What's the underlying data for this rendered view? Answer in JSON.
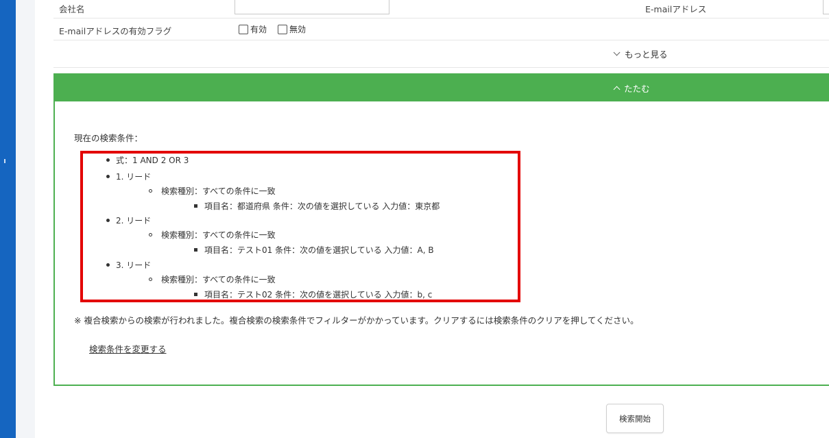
{
  "form": {
    "company_label": "会社名",
    "company_value": "",
    "email_label": "E-mailアドレス",
    "email_value": "",
    "flag_label": "E-mailアドレスの有効フラグ",
    "flag_options": [
      {
        "label": "有効",
        "checked": false
      },
      {
        "label": "無効",
        "checked": false
      }
    ],
    "more_label": "もっと見る"
  },
  "panel": {
    "collapse_label": "たたむ",
    "current_conditions_label": "現在の検索条件：",
    "conditions": {
      "expression": "式：1 AND 2 OR 3",
      "groups": [
        {
          "title": "1. リード",
          "match_type": "検索種別：すべての条件に一致",
          "condition": "項目名：都道府県 条件：次の値を選択している 入力値：東京都"
        },
        {
          "title": "2. リード",
          "match_type": "検索種別：すべての条件に一致",
          "condition": "項目名：テスト01 条件：次の値を選択している 入力値：A, B"
        },
        {
          "title": "3. リード",
          "match_type": "検索種別：すべての条件に一致",
          "condition": "項目名：テスト02 条件：次の値を選択している 入力値：b, c"
        }
      ]
    },
    "note": "※ 複合検索からの検索が行われました。複合検索の検索条件でフィルターがかかっています。クリアするには検索条件のクリアを押してください。",
    "change_link": "検索条件を変更する"
  },
  "actions": {
    "search_button": "検索開始"
  },
  "colors": {
    "sidebar": "#1565c0",
    "panel_accent": "#4caf50",
    "highlight_box": "#e30000"
  }
}
